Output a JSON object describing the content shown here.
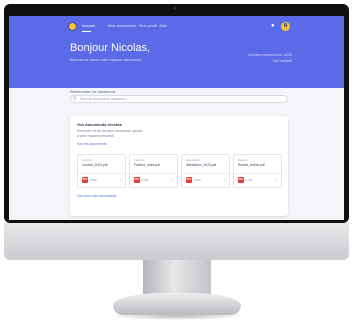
{
  "header": {
    "nav_items": [
      "Accueil",
      "Mes documents",
      "Mon profil",
      "Aide"
    ],
    "greeting": "Bonjour Nicolas,",
    "subtitle": "Bienvenue dans votre espace personnel",
    "info_line1": "Dernière connexion le 12/03",
    "info_line2": "Voir l'activité",
    "avatar_initial": "N"
  },
  "search": {
    "label": "Rechercher un document",
    "placeholder": "Nom du document, catégorie..."
  },
  "card": {
    "title": "Vos documents récents",
    "desc1": "Retrouvez ici les derniers documents ajoutés",
    "desc2": "à votre espace personnel",
    "link": "Voir les documents",
    "documents": [
      {
        "category": "Contrat",
        "name": "Contrat_2023.pdf",
        "size": "3 Mo"
      },
      {
        "category": "Facture",
        "name": "Facture_mars.pdf",
        "size": "1 Mo"
      },
      {
        "category": "Attestation",
        "name": "Attestation_2023.pdf",
        "size": "2 Mo"
      },
      {
        "category": "Relevé",
        "name": "Releve_fevrier.pdf",
        "size": "1 Mo"
      }
    ],
    "footer": "Voir tous mes documents"
  }
}
